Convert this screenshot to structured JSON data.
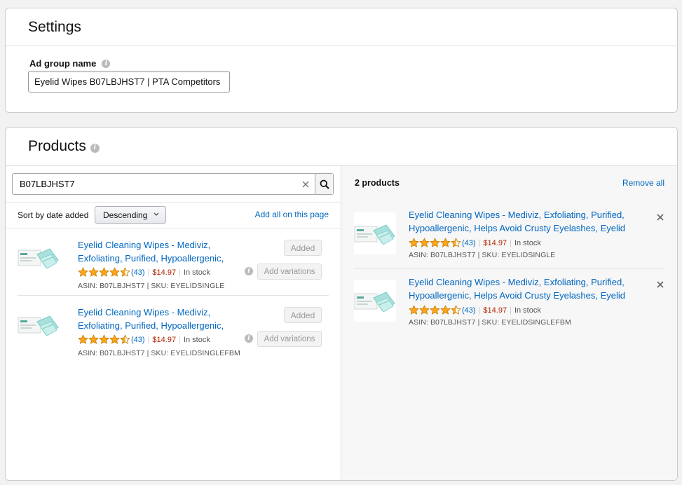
{
  "settings": {
    "title": "Settings",
    "ad_group_label": "Ad group name",
    "ad_group_value": "Eyelid Wipes B07LBJHST7 | PTA Competitors"
  },
  "products": {
    "title": "Products",
    "search_value": "B07LBJHST7",
    "sort_label": "Sort by date added",
    "sort_value": "Descending",
    "add_all_label": "Add all on this page",
    "results": [
      {
        "title": "Eyelid Cleaning Wipes - Mediviz, Exfoliating, Purified, Hypoallergenic, Helps Avoid Crusty Eyelashes, Eyelid",
        "rating": 4.5,
        "rating_count": "(43)",
        "price": "$14.97",
        "stock": "In stock",
        "ids": "ASIN: B07LBJHST7 | SKU: EYELIDSINGLE",
        "added_label": "Added",
        "variations_label": "Add variations"
      },
      {
        "title": "Eyelid Cleaning Wipes - Mediviz, Exfoliating, Purified, Hypoallergenic, Helps Avoid Crusty Eyelashes, Eyelid",
        "rating": 4.5,
        "rating_count": "(43)",
        "price": "$14.97",
        "stock": "In stock",
        "ids": "ASIN: B07LBJHST7 | SKU: EYELIDSINGLEFBM",
        "added_label": "Added",
        "variations_label": "Add variations"
      }
    ],
    "selected_count": "2 products",
    "remove_all_label": "Remove all",
    "selected": [
      {
        "title": "Eyelid Cleaning Wipes - Mediviz, Exfoliating, Purified, Hypoallergenic, Helps Avoid Crusty Eyelashes, Eyelid",
        "rating": 4.5,
        "rating_count": "(43)",
        "price": "$14.97",
        "stock": "In stock",
        "ids": "ASIN: B07LBJHST7 | SKU: EYELIDSINGLE"
      },
      {
        "title": "Eyelid Cleaning Wipes - Mediviz, Exfoliating, Purified, Hypoallergenic, Helps Avoid Crusty Eyelashes, Eyelid",
        "rating": 4.5,
        "rating_count": "(43)",
        "price": "$14.97",
        "stock": "In stock",
        "ids": "ASIN: B07LBJHST7 | SKU: EYELIDSINGLEFBM"
      }
    ]
  },
  "colors": {
    "link": "#0066c0",
    "price": "#b12704",
    "star": "#ffa41c"
  }
}
